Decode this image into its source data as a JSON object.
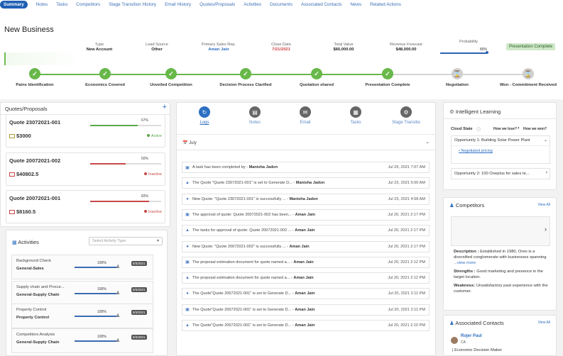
{
  "tabs": [
    "Summary",
    "Notes",
    "Tasks",
    "Competitors",
    "Stage Transition History",
    "Email History",
    "Quotes/Proposals",
    "Activities",
    "Documents",
    "Associated Contacts",
    "News",
    "Related Actions"
  ],
  "page_title": "New Business",
  "summary": [
    {
      "label": "Type",
      "value": "New Account"
    },
    {
      "label": "Lead Source",
      "value": "Other"
    },
    {
      "label": "Primary Sales Rep.",
      "value": "Aman Jain"
    },
    {
      "label": "Close Date",
      "value": "7/21/2021"
    },
    {
      "label": "Total Value",
      "value": "$60,000.00"
    },
    {
      "label": "Revenue Forecast",
      "value": "$48,000.00"
    }
  ],
  "probability": {
    "label": "Probability",
    "value": "80%",
    "fraction": 0.8
  },
  "presentation_badge": "Presentation Complete",
  "stages": [
    {
      "label": "Pains Identification",
      "done": true
    },
    {
      "label": "Economics Covered",
      "done": true
    },
    {
      "label": "Unveiled Competition",
      "done": true
    },
    {
      "label": "Decision Process Clarified",
      "done": true
    },
    {
      "label": "Quotation shared",
      "done": true
    },
    {
      "label": "Presentation Complete",
      "done": true
    },
    {
      "label": "Negotiation",
      "done": false
    },
    {
      "label": "Won - Commitment Received",
      "done": false
    }
  ],
  "quotes": {
    "title": "Quotes/Proposals",
    "add": "+",
    "items": [
      {
        "name": "Quote 23072021-001",
        "amount": "$3000",
        "percent": "67%",
        "fraction": 0.67,
        "status": "Active",
        "color": "#5aa84a"
      },
      {
        "name": "Quote 20072021-002",
        "amount": "$40802.5",
        "percent": "50%",
        "fraction": 0.5,
        "status": "Inactive",
        "color": "#c84848"
      },
      {
        "name": "Quote 20072021-001",
        "amount": "$8160.5",
        "percent": "83%",
        "fraction": 0.83,
        "status": "Inactive",
        "color": "#c84848"
      }
    ]
  },
  "activities": {
    "title": "Activities",
    "select_placeholder": "Select Activity Type",
    "items": [
      {
        "name": "Background Check",
        "type": "General-Sales",
        "percent": "100%",
        "date": "8/3/2021"
      },
      {
        "name": "Supply chain and Procur...",
        "type": "General-Supply Chain",
        "percent": "100%",
        "date": "8/3/2021"
      },
      {
        "name": "Property Control",
        "type": "Property Control",
        "percent": "100%",
        "date": "8/3/2021"
      },
      {
        "name": "Competitors Analysis",
        "type": "General-Supply Chain",
        "percent": "100%",
        "date": "8/3/2021"
      }
    ]
  },
  "log_tabs": [
    "Logs",
    "Notes",
    "Email",
    "Tasks",
    "Stage Transitio"
  ],
  "month": "July",
  "logs": [
    {
      "text": "A task has been completed by ",
      "user": "Manisha Jadon",
      "date": "Jul 29, 2021 7:07 AM"
    },
    {
      "text": "The Quote \"Quote 23072021-001\" is set to Generate D... ",
      "user": "Manisha Jadon",
      "date": "Jul 23, 2021 5:00 AM"
    },
    {
      "text": "New Quote: \"Quote 23072021-001\" is successfully ... ",
      "user": "Manisha Jadon",
      "date": "Jul 23, 2021 4:58 AM"
    },
    {
      "text": "The approval of quote: Quote 20072021-002 has been... ",
      "user": "Aman Jain",
      "date": "Jul 20, 2021 2:17 PM"
    },
    {
      "text": "The tasks for approval of quote: Quote 20072021-002 ... ",
      "user": "Aman Jain",
      "date": "Jul 20, 2021 2:17 PM"
    },
    {
      "text": "New Quote: \"Quote 20072021-002\" is successfully ... ",
      "user": "Aman Jain",
      "date": "Jul 20, 2021 2:17 PM"
    },
    {
      "text": "The proposal estimation document for quote named a... ",
      "user": "Aman Jain",
      "date": "Jul 20, 2021 2:12 PM"
    },
    {
      "text": "The proposal estimation document for quote named a... ",
      "user": "Aman Jain",
      "date": "Jul 20, 2021 2:12 PM"
    },
    {
      "text": "The Quote\"Quote 20072021-001\" is set to Generate D... ",
      "user": "Aman Jain",
      "date": "Jul 20, 2021 2:11 PM"
    },
    {
      "text": "The Quote\"Quote 20072021-001\" is set to Generate D... ",
      "user": "Aman Jain",
      "date": "Jul 20, 2021 2:11 PM"
    },
    {
      "text": "The Quote\"Quote 20072021-001\" is set to Generate D... ",
      "user": "Aman Jain",
      "date": "Jul 20, 2021 2:10 PM"
    }
  ],
  "intelligent": {
    "title": "Intelligent Learning",
    "cloud_state": "Cloud State",
    "how_lose": "How we lose?",
    "how_win": "How we won?",
    "opp1": "Opportunity 1: Building Solar Power Plant",
    "opp1_link": "Negotiated pricing",
    "opp2": "Opportunity 2: 100 Oneplus for sales te..."
  },
  "competitors": {
    "title": "Competitors",
    "view_all": "View All",
    "desc_label": "Description :",
    "desc": "Established in 1980, Oreo is a diversified conglomerate with businesses spanning",
    "view_more": "...view more",
    "str_label": "Strengths :",
    "strengths": "Good marketing and presence in the target location.",
    "weak_label": "Weakness:",
    "weakness": "Unsatisfactory past experience with the customer."
  },
  "contacts": {
    "title": "Associated Contacts",
    "view_all": "View All",
    "name": "Rojer Paul",
    "role": "CA",
    "tag": "| Economic Decision Maker"
  }
}
